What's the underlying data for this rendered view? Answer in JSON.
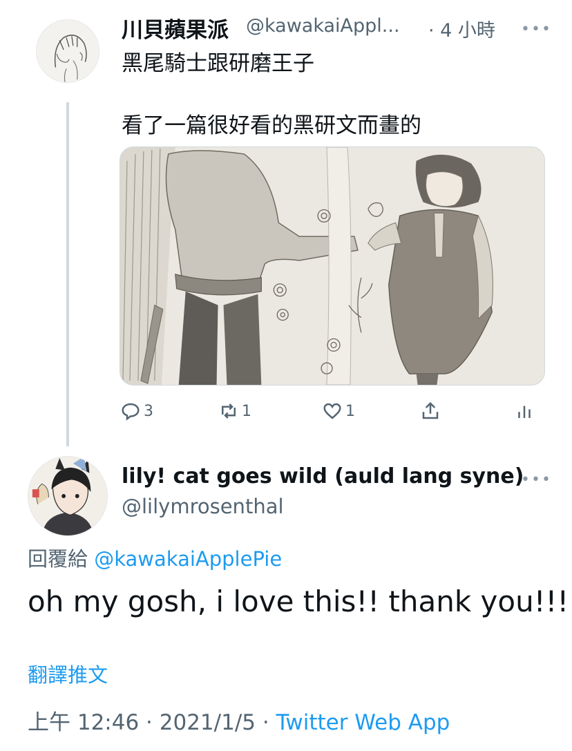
{
  "parent": {
    "display_name": "川貝蘋果派",
    "handle": "@kawakaiAppl...",
    "time": "· 4 小時",
    "more_icon": "more-icon",
    "text_line1": "黑尾騎士跟研磨王子",
    "text_line2": "看了一篇很好看的黑研文而畫的",
    "actions": {
      "reply_count": "3",
      "retweet_count": "1",
      "like_count": "1"
    }
  },
  "reply": {
    "display_name": "lily! cat goes wild (auld lang syne)",
    "handle": "@lilymrosenthal",
    "replying_prefix": "回覆給",
    "replying_to": "@kawakaiApplePie",
    "text": "oh my gosh, i love this!! thank you!!!",
    "translate_label": "翻譯推文",
    "timestamp": "上午 12:46 · 2021/1/5 · ",
    "source": "Twitter Web App"
  },
  "colors": {
    "accent": "#1d9bf0",
    "secondary_text": "#536471",
    "thread_line": "#cfd9de"
  }
}
